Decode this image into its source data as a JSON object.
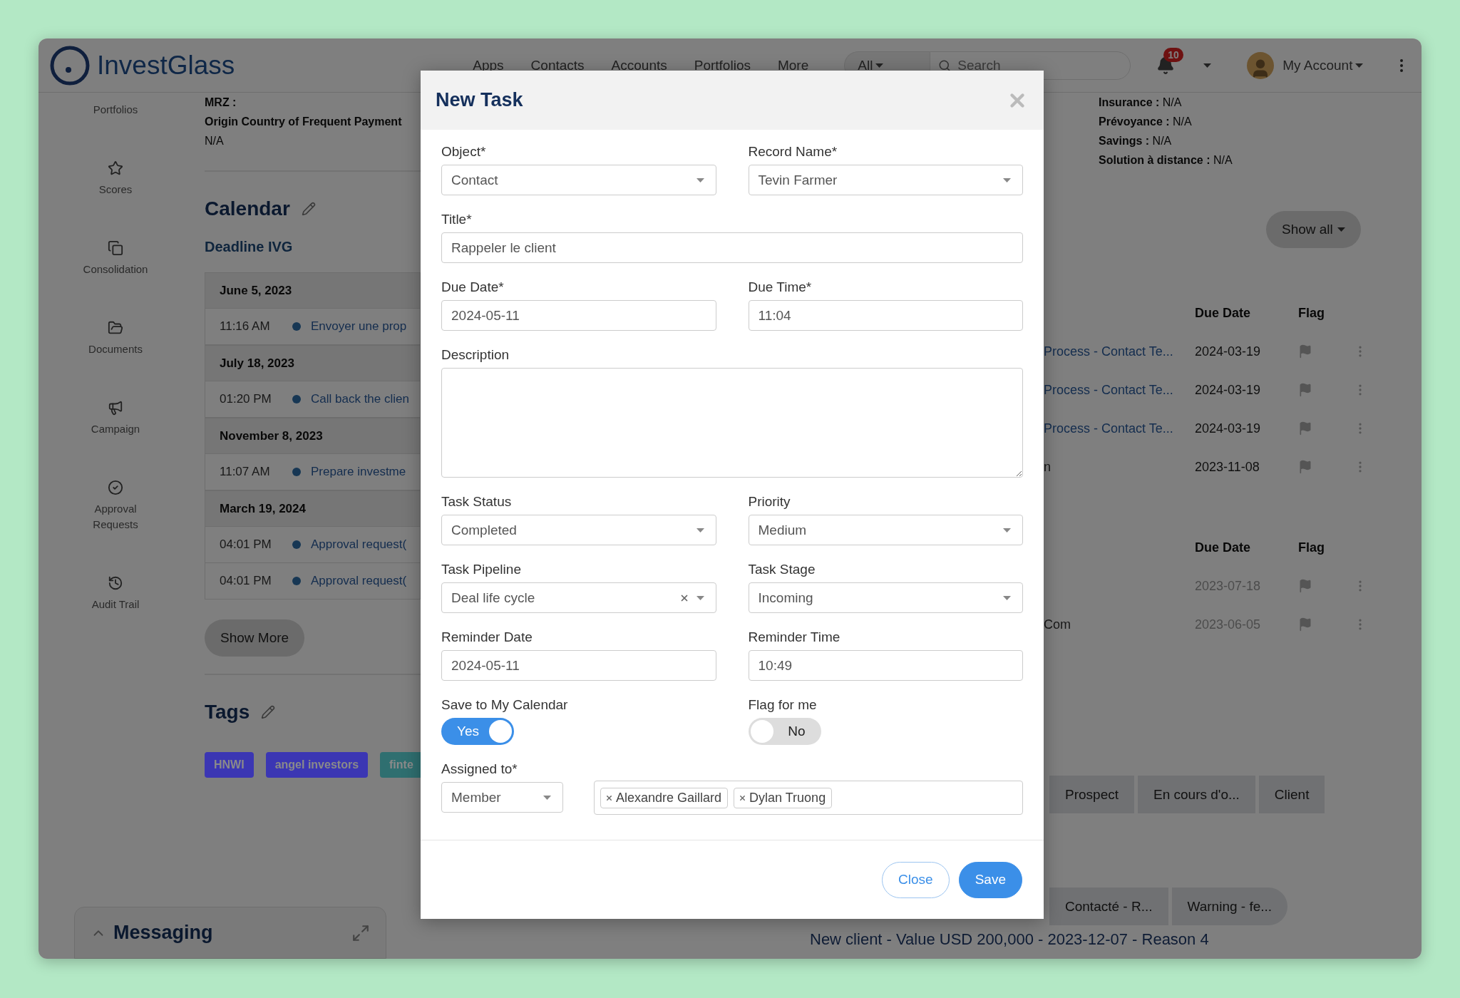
{
  "header": {
    "logo": "InvestGlass",
    "nav": [
      "Apps",
      "Contacts",
      "Accounts",
      "Portfolios",
      "More"
    ],
    "scope": "All",
    "search": {
      "placeholder": "Search"
    },
    "notifications": "10",
    "account": "My Account"
  },
  "sidebar": {
    "items": [
      "Portfolios",
      "Scores",
      "Consolidation",
      "Documents",
      "Campaign",
      "Approval Requests",
      "Audit Trail"
    ]
  },
  "profile": {
    "lines": [
      {
        "kind": "label",
        "text": "MRZ :"
      },
      {
        "kind": "label",
        "text": "Origin Country of Frequent Payment"
      },
      {
        "kind": "value",
        "text": "N/A"
      }
    ]
  },
  "calendar": {
    "title": "Calendar",
    "subtitle": "Deadline IVG",
    "show_more": "Show More",
    "days": [
      {
        "date": "June 5, 2023",
        "events": [
          {
            "time": "11:16 AM",
            "title": "Envoyer une prop"
          }
        ]
      },
      {
        "date": "July 18, 2023",
        "events": [
          {
            "time": "01:20 PM",
            "title": "Call back the clien"
          }
        ]
      },
      {
        "date": "November 8, 2023",
        "events": [
          {
            "time": "11:07 AM",
            "title": "Prepare investme"
          }
        ]
      },
      {
        "date": "March 19, 2024",
        "events": [
          {
            "time": "04:01 PM",
            "title": "Approval request("
          },
          {
            "time": "04:01 PM",
            "title": "Approval request("
          }
        ]
      }
    ]
  },
  "tags": {
    "title": "Tags",
    "items": [
      {
        "label": "HNWI",
        "color": "#3b36b3"
      },
      {
        "label": "angel investors",
        "color": "#3b36b3"
      },
      {
        "label": "finte",
        "color": "#2f6f70"
      }
    ]
  },
  "messaging": {
    "title": "Messaging"
  },
  "details": [
    {
      "label": "Insurance :",
      "value": "N/A"
    },
    {
      "label": "Prévoyance :",
      "value": "N/A"
    },
    {
      "label": "Savings :",
      "value": "N/A"
    },
    {
      "label": "Solution à distance :",
      "value": "N/A"
    }
  ],
  "tasks": {
    "show_all": "Show all",
    "tables": [
      {
        "columns": [
          "Due Date",
          "Flag"
        ],
        "rows": [
          {
            "kind": "link",
            "name": "Process - Contact Te...",
            "due": "2024-03-19",
            "greyed": false
          },
          {
            "kind": "link",
            "name": "Process - Contact Te...",
            "due": "2024-03-19",
            "greyed": false
          },
          {
            "kind": "link",
            "name": "Process - Contact Te...",
            "due": "2024-03-19",
            "greyed": false
          },
          {
            "kind": "text",
            "name": "n",
            "due": "2023-11-08",
            "greyed": false
          }
        ]
      },
      {
        "columns": [
          "Due Date",
          "Flag"
        ],
        "rows": [
          {
            "due": "2023-07-18",
            "greyed": true
          },
          {
            "kind": "text",
            "name": "Com",
            "due": "2023-06-05",
            "greyed": true
          }
        ]
      }
    ]
  },
  "stages": [
    {
      "items": [
        "Prospect",
        "En cours d'o...",
        "Client"
      ]
    },
    {
      "items": [
        "Contacté - R...",
        "Warning - fe..."
      ]
    }
  ],
  "note": "New client - Value USD 200,000 - 2023-12-07 - Reason 4",
  "modal": {
    "title": "New Task",
    "rows": [
      {
        "fields": [
          {
            "label": "Object*",
            "kind": "select",
            "value": "Contact"
          },
          {
            "label": "Record Name*",
            "kind": "select",
            "value": "Tevin Farmer"
          }
        ]
      },
      {
        "fields": [
          {
            "label": "Title*",
            "kind": "text",
            "value": "Rappeler le client"
          }
        ]
      },
      {
        "fields": [
          {
            "label": "Due Date*",
            "kind": "text",
            "value": "2024-05-11"
          },
          {
            "label": "Due Time*",
            "kind": "text",
            "value": "11:04"
          }
        ]
      },
      {
        "fields": [
          {
            "label": "Description",
            "kind": "textarea"
          }
        ]
      },
      {
        "fields": [
          {
            "label": "Task Status",
            "kind": "select",
            "value": "Completed"
          },
          {
            "label": "Priority",
            "kind": "select",
            "value": "Medium"
          }
        ]
      },
      {
        "fields": [
          {
            "label": "Task Pipeline",
            "kind": "select",
            "value": "Deal life cycle",
            "clearable": true
          },
          {
            "label": "Task Stage",
            "kind": "select",
            "value": "Incoming"
          }
        ]
      },
      {
        "fields": [
          {
            "label": "Reminder Date",
            "kind": "text",
            "value": "2024-05-11"
          },
          {
            "label": "Reminder Time",
            "kind": "text",
            "value": "10:49"
          }
        ]
      },
      {
        "fields": [
          {
            "label": "Save to My Calendar",
            "kind": "toggle",
            "on": true,
            "text": "Yes"
          },
          {
            "label": "Flag for me",
            "kind": "toggle",
            "on": false,
            "text": "No"
          }
        ]
      },
      {
        "fields": [
          {
            "label": "Assigned to*",
            "kind": "assign",
            "value": "Member",
            "people": [
              "Alexandre Gaillard",
              "Dylan Truong"
            ]
          }
        ]
      }
    ],
    "buttons": [
      {
        "label": "Close",
        "kind": "secondary"
      },
      {
        "label": "Save",
        "kind": "primary"
      }
    ]
  }
}
